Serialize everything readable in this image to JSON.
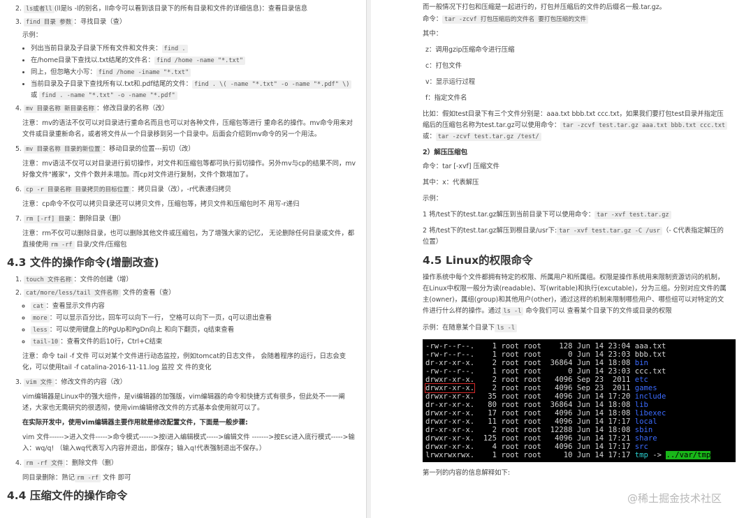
{
  "left": {
    "items_a": [
      {
        "num": "2.",
        "cmd": "ls或者ll",
        "text": "(ll是ls -l的别名，ll命令可以看到该目录下的所有目录和文件的详细信息)：查看目录信息"
      },
      {
        "num": "3.",
        "cmd": "find 目录 参数",
        "text": "：寻找目录（查）"
      }
    ],
    "example_label": "示例：",
    "find_examples": [
      {
        "text": "列出当前目录及子目录下所有文件和文件夹：",
        "code": "find ."
      },
      {
        "text": "在/home目录下查找以.txt结尾的文件名：",
        "code": "find /home -name \"*.txt\""
      },
      {
        "text": "同上，但忽略大小写：",
        "code": "find /home -iname \"*.txt\""
      },
      {
        "text": "当前目录及子目录下查找所有以.txt和.pdf结尾的文件：",
        "code": "find . \\( -name \"*.txt\" -o -name \"*.pdf\" \\)",
        "tail": " 或 ",
        "code2": "find . -name \"*.txt\" -o -name \"*.pdf\""
      }
    ],
    "item4": {
      "num": "4.",
      "cmd": "mv 目录名称 新目录名称",
      "text": "：修改目录的名称（改）"
    },
    "note4": "注意：mv的语法不仅可以对目录进行重命名而且也可以对各种文件，压缩包等进行 重命名的操作。mv命令用来对文件或目录重新命名，或者将文件从一个目录移到另一个目录中。后面会介绍到mv命令的另一个用法。",
    "item5": {
      "num": "5.",
      "cmd": "mv 目录名称 目录的新位置",
      "text": "：移动目录的位置---剪切（改）"
    },
    "note5": "注意：mv语法不仅可以对目录进行剪切操作，对文件和压缩包等都可执行剪切操作。另外mv与cp的结果不同，mv好像文件\"搬家\"，文件个数并未增加。而cp对文件进行复制，文件个数增加了。",
    "item6": {
      "num": "6.",
      "cmd": "cp -r 目录名称 目录拷贝的目标位置",
      "text": "：拷贝目录（改），-r代表递归拷贝"
    },
    "note6": "注意：cp命令不仅可以拷贝目录还可以拷贝文件，压缩包等，拷贝文件和压缩包时不 用写-r递归",
    "item7": {
      "num": "7.",
      "cmd": "rm [-rf] 目录",
      "text": "：删除目录（删）"
    },
    "note7a": "注意：rm不仅可以删除目录，也可以删除其他文件或压缩包，为了增强大家的记忆， 无论删除任何目录或文件，都直接使用",
    "note7code": "rm -rf",
    "note7b": " 目录/文件/压缩包",
    "h43": "4.3 文件的操作命令(增删改查)",
    "f_items": [
      {
        "num": "1.",
        "cmd": "touch 文件名称",
        "text": "：文件的创建（增）"
      },
      {
        "num": "2.",
        "cmd": "cat/more/less/tail 文件名称",
        "text": " 文件的查看（查）"
      }
    ],
    "view_cmds": [
      {
        "code": "cat",
        "text": "：查看显示文件内容"
      },
      {
        "code": "more",
        "text": "：可以显示百分比，回车可以向下一行， 空格可以向下一页，q可以退出查看"
      },
      {
        "code": "less",
        "text": "：可以使用键盘上的PgUp和PgDn向上 和向下翻页，q结束查看"
      },
      {
        "code": "tail-10",
        "text": "：查看文件的后10行，Ctrl+C结束"
      }
    ],
    "note_tail": "注意：命令 tail -f 文件 可以对某个文件进行动态监控，例如tomcat的日志文件， 会随着程序的运行，日志会变化，可以使用tail -f catalina-2016-11-11.log 监控 文 件的变化",
    "item3f": {
      "num": "3.",
      "cmd": "vim 文件",
      "text": "：修改文件的内容（改）"
    },
    "vim_para": "vim编辑器是Linux中的强大组件，是vi编辑器的加强版，vim编辑器的命令和快捷方式有很多，但此处不一一阐述，大家也无需研究的很透彻，使用vim编辑修改文件的方式基本会使用就可以了。",
    "vim_bold": "在实际开发中，使用vim编辑器主要作用就是修改配置文件，下面是一般步骤:",
    "vim_steps": "vim 文件------>进入文件----->命令模式------>按i进入编辑模式----->编辑文件 ------->按Esc进入底行模式----->输入：wq/q! （输入wq代表写入内容并退出，即保存；输入q!代表强制退出不保存。）",
    "item4f": {
      "num": "4.",
      "cmd": "rm -rf 文件",
      "text": "：删除文件（删）"
    },
    "same_del": "同目录删除：熟记",
    "same_code": "rm -rf",
    "same_tail": " 文件 即可",
    "h44": "4.4 压缩文件的操作命令"
  },
  "right": {
    "top1": "而一般情况下打包和压缩是一起进行的，打包并压缩后的文件的后缀名一般.tar.gz。",
    "cmd_label": "命令：",
    "cmd_code": "tar -zcvf 打包压缩后的文件名 要打包压缩的文件",
    "among": "其中：",
    "opts": [
      "z：调用gzip压缩命令进行压缩",
      "c：打包文件",
      "v：显示运行过程",
      "f：指定文件名"
    ],
    "example1": "比如：假如test目录下有三个文件分别是：aaa.txt bbb.txt ccc.txt，如果我们要打包test目录并指定压缩后的压缩包名称为test.tar.gz可以使用命令：",
    "example1_code": "tar -zcvf test.tar.gz aaa.txt bbb.txt ccc.txt",
    "example1_or": "或：",
    "example1_code2": "tar -zcvf test.tar.gz      /test/",
    "h_unzip": "2）解压压缩包",
    "unzip_cmd": "命令：tar [-xvf] 压缩文件",
    "unzip_x": "其中：x：代表解压",
    "example_label": "示例：",
    "ex1_text": "1 将/test下的test.tar.gz解压到当前目录下可以使用命令：",
    "ex1_code": "tar -xvf test.tar.gz",
    "ex2_text": "2 将/test下的test.tar.gz解压到根目录/usr下:",
    "ex2_code": "tar -xvf test.tar.gz -C /usr",
    "ex2_tail": "（- C代表指定解压的位置）",
    "h45": "4.5 Linux的权限命令",
    "perm_para": "操作系统中每个文件都拥有特定的权限、所属用户和所属组。权限是操作系统用来限制资源访问的机制，在Linux中权限一般分为读(readable)、写(writable)和执行(excutable)，分为三组。分别对应文件的属主(owner)，属组(group)和其他用户(other)，通过这样的机制来限制哪些用户、哪些组可以对特定的文件进行什么样的操作。通过",
    "perm_code": "ls -l",
    "perm_tail": " 命令我们可以 查看某个目录下的文件或目录的权限",
    "ex_label": "示例：在随意某个目录下",
    "ex_code": "ls -l",
    "terminal": [
      {
        "perm": "-rw-r--r--.",
        "n": "1",
        "u": "root",
        "g": "root",
        "size": "128",
        "mon": "Jun",
        "day": "14",
        "time": "23:04",
        "name": "aaa.txt",
        "kind": "file"
      },
      {
        "perm": "-rw-r--r--.",
        "n": "1",
        "u": "root",
        "g": "root",
        "size": "0",
        "mon": "Jun",
        "day": "14",
        "time": "23:03",
        "name": "bbb.txt",
        "kind": "file"
      },
      {
        "perm": "dr-xr-xr-x.",
        "n": "2",
        "u": "root",
        "g": "root",
        "size": "36864",
        "mon": "Jun",
        "day": "14",
        "time": "18:08",
        "name": "bin",
        "kind": "dir"
      },
      {
        "perm": "-rw-r--r--.",
        "n": "1",
        "u": "root",
        "g": "root",
        "size": "0",
        "mon": "Jun",
        "day": "14",
        "time": "23:03",
        "name": "ccc.txt",
        "kind": "file"
      },
      {
        "perm": "drwxr-xr-x.",
        "n": "2",
        "u": "root",
        "g": "root",
        "size": "4096",
        "mon": "Sep",
        "day": "23",
        "time": "2011",
        "name": "etc",
        "kind": "dir"
      },
      {
        "perm": "drwxr-xr-x.",
        "n": "2",
        "u": "root",
        "g": "root",
        "size": "4096",
        "mon": "Sep",
        "day": "23",
        "time": "2011",
        "name": "games",
        "kind": "dir",
        "hl": true
      },
      {
        "perm": "drwxr-xr-x.",
        "n": "35",
        "u": "root",
        "g": "root",
        "size": "4096",
        "mon": "Jun",
        "day": "14",
        "time": "17:20",
        "name": "include",
        "kind": "dir"
      },
      {
        "perm": "dr-xr-xr-x.",
        "n": "80",
        "u": "root",
        "g": "root",
        "size": "36864",
        "mon": "Jun",
        "day": "14",
        "time": "18:08",
        "name": "lib",
        "kind": "dir"
      },
      {
        "perm": "drwxr-xr-x.",
        "n": "17",
        "u": "root",
        "g": "root",
        "size": "4096",
        "mon": "Jun",
        "day": "14",
        "time": "18:08",
        "name": "libexec",
        "kind": "dir"
      },
      {
        "perm": "drwxr-xr-x.",
        "n": "11",
        "u": "root",
        "g": "root",
        "size": "4096",
        "mon": "Jun",
        "day": "14",
        "time": "17:17",
        "name": "local",
        "kind": "dir"
      },
      {
        "perm": "dr-xr-xr-x.",
        "n": "2",
        "u": "root",
        "g": "root",
        "size": "12288",
        "mon": "Jun",
        "day": "14",
        "time": "18:08",
        "name": "sbin",
        "kind": "dir"
      },
      {
        "perm": "drwxr-xr-x.",
        "n": "125",
        "u": "root",
        "g": "root",
        "size": "4096",
        "mon": "Jun",
        "day": "14",
        "time": "17:21",
        "name": "share",
        "kind": "dir"
      },
      {
        "perm": "drwxr-xr-x.",
        "n": "4",
        "u": "root",
        "g": "root",
        "size": "4096",
        "mon": "Jun",
        "day": "14",
        "time": "17:17",
        "name": "src",
        "kind": "dir"
      },
      {
        "perm": "lrwxrwxrwx.",
        "n": "1",
        "u": "root",
        "g": "root",
        "size": "10",
        "mon": "Jun",
        "day": "14",
        "time": "17:17",
        "name": "tmp",
        "kind": "link",
        "arrow": "->",
        "target": "../var/tmp"
      }
    ],
    "after_term": "第一列的内容的信息解释如下:",
    "watermark": "@稀土掘金技术社区"
  }
}
